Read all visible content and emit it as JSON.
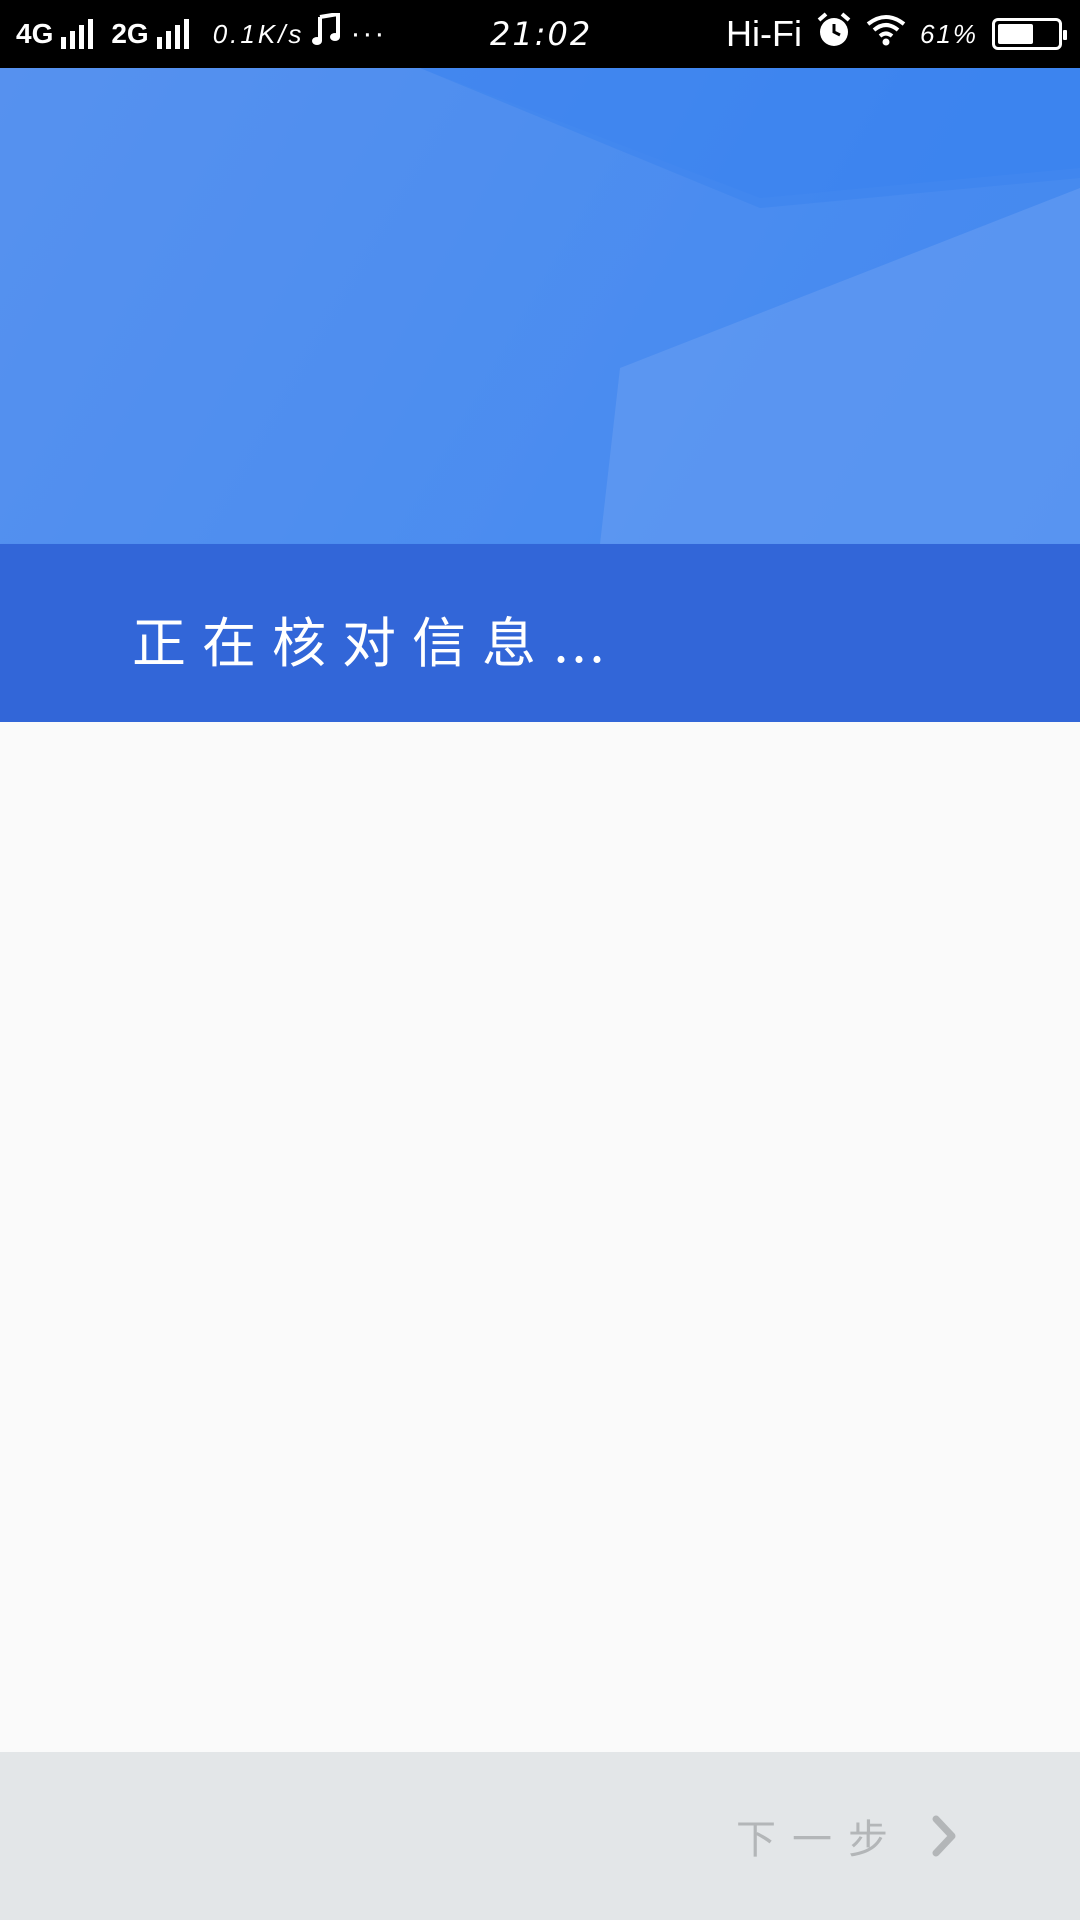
{
  "status_bar": {
    "network_1": "4G",
    "network_2": "2G",
    "speed": "0.1K/s",
    "more": "···",
    "time": "21:02",
    "hifi": "Hi-Fi",
    "battery_percent": "61%",
    "battery_level": 0.61,
    "icons": [
      "signal-icon",
      "music-note-icon",
      "alarm-icon",
      "wifi-icon",
      "battery-icon"
    ]
  },
  "banner": {
    "status_text": "正在核对信息…"
  },
  "bottom_bar": {
    "next_label": "下一步",
    "next_icon": "chevron-right-icon"
  },
  "colors": {
    "hero_blue": "#4a8bef",
    "banner_blue": "#3266d8",
    "bottom_bar_bg": "#e3e6e8",
    "disabled_text": "#b3b6b8",
    "content_bg": "#fafafa"
  }
}
